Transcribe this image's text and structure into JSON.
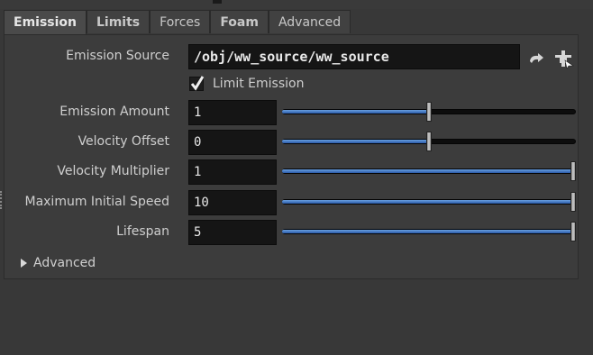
{
  "tabs": [
    {
      "label": "Emission",
      "active": true,
      "bold": true
    },
    {
      "label": "Limits",
      "active": false,
      "bold": true
    },
    {
      "label": "Forces",
      "active": false,
      "bold": false
    },
    {
      "label": "Foam",
      "active": false,
      "bold": true
    },
    {
      "label": "Advanced",
      "active": false,
      "bold": false
    }
  ],
  "emission_source": {
    "label": "Emission Source",
    "value": "/obj/ww_source/ww_source"
  },
  "limit_emission": {
    "label": "Limit Emission",
    "checked": true
  },
  "params": [
    {
      "label": "Emission Amount",
      "value": "1",
      "slider_fraction": 0.5
    },
    {
      "label": "Velocity Offset",
      "value": "0",
      "slider_fraction": 0.5
    },
    {
      "label": "Velocity Multiplier",
      "value": "1",
      "slider_fraction": 1.0
    },
    {
      "label": "Maximum Initial Speed",
      "value": "10",
      "slider_fraction": 1.0
    },
    {
      "label": "Lifespan",
      "value": "5",
      "slider_fraction": 1.0
    }
  ],
  "advanced_section": {
    "label": "Advanced",
    "expanded": false
  },
  "icons": {
    "source_action_1": "jump-arrow-icon",
    "source_action_2": "node-chooser-icon"
  }
}
